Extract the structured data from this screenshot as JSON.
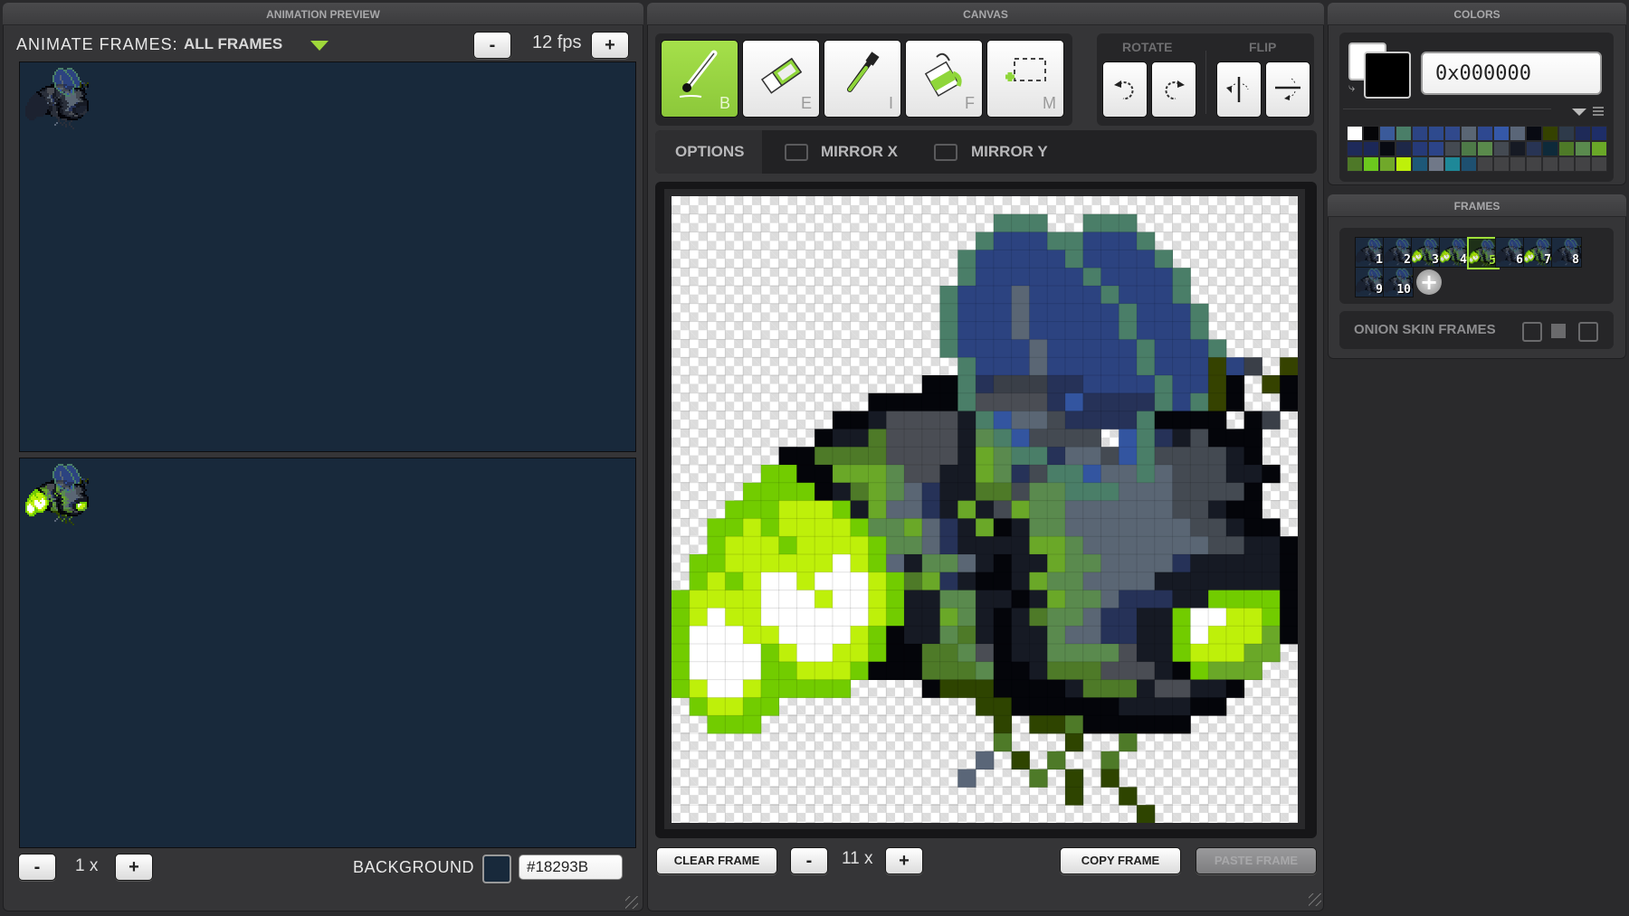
{
  "preview": {
    "header": "ANIMATION PREVIEW",
    "animate_label": "ANIMATE FRAMES:",
    "animate_value": "ALL FRAMES",
    "fps_minus": "-",
    "fps_value": "12 fps",
    "fps_plus": "+",
    "zoom_minus": "-",
    "zoom_value": "1 x",
    "zoom_plus": "+",
    "background_label": "BACKGROUND",
    "background_value": "#18293B",
    "background_color": "#18293B"
  },
  "canvas": {
    "header": "CANVAS",
    "tools": [
      {
        "name": "brush",
        "key": "B",
        "active": true
      },
      {
        "name": "eraser",
        "key": "E",
        "active": false
      },
      {
        "name": "eyedropper",
        "key": "I",
        "active": false
      },
      {
        "name": "fill",
        "key": "F",
        "active": false
      },
      {
        "name": "marquee",
        "key": "M",
        "active": false
      }
    ],
    "rotate_label": "ROTATE",
    "flip_label": "FLIP",
    "options_label": "OPTIONS",
    "mirror_x_label": "MIRROR X",
    "mirror_y_label": "MIRROR Y",
    "mirror_x_checked": false,
    "mirror_y_checked": false,
    "clear_frame": "CLEAR FRAME",
    "zoom_minus": "-",
    "zoom_value": "11 x",
    "zoom_plus": "+",
    "copy_frame": "COPY FRAME",
    "paste_frame": "PASTE FRAME",
    "paste_disabled": true
  },
  "colors": {
    "header": "COLORS",
    "primary": "#000000",
    "secondary": "#FFFFFF",
    "hex_value": "0x000000",
    "palette": [
      "#ffffff",
      "#050508",
      "#3a5a9a",
      "#4a7e68",
      "#2c4484",
      "#2e4a8e",
      "#30498c",
      "#5a6674",
      "#2e4890",
      "#3558a8",
      "#5a6678",
      "#080a12",
      "#354200",
      "#2e3a4a",
      "#1e2a58",
      "#1e2e68",
      "#1e2a5a",
      "#1c2858",
      "#080a12",
      "#1e2848",
      "#263a78",
      "#2c4488",
      "#444a52",
      "#4e7a48",
      "#5a8a4c",
      "#444a52",
      "#161a24",
      "#283454",
      "#0e2a3a",
      "#4e7a28",
      "#5a8a4e",
      "#6aa828",
      "#4e7828",
      "#6cc81e",
      "#70a82a",
      "#bef00a",
      "#1e5878",
      "#707888",
      "#1e8898",
      "#1e5070",
      "#434345",
      "#434345",
      "#434345",
      "#434345",
      "#434345",
      "#434345",
      "#434345",
      "#434345"
    ]
  },
  "frames": {
    "header": "FRAMES",
    "items": [
      {
        "num": "1",
        "selected": false,
        "glow": false
      },
      {
        "num": "2",
        "selected": false,
        "glow": false
      },
      {
        "num": "3",
        "selected": false,
        "glow": true
      },
      {
        "num": "4",
        "selected": false,
        "glow": true
      },
      {
        "num": "5",
        "selected": true,
        "glow": true
      },
      {
        "num": "6",
        "selected": false,
        "glow": false
      },
      {
        "num": "7",
        "selected": false,
        "glow": true
      },
      {
        "num": "8",
        "selected": false,
        "glow": false
      },
      {
        "num": "9",
        "selected": false,
        "glow": false
      },
      {
        "num": "10",
        "selected": false,
        "glow": false
      }
    ],
    "add_label": "+",
    "onion_label": "ONION SKIN FRAMES"
  },
  "sprite": {
    "palette": {
      "g": "#4a7e68",
      "b": "#2c4380",
      "s": "#5a6674",
      "o": "#354200",
      "D": "#3a3f48",
      "k": "#04050a",
      "n": "#263258",
      "d": "#161a24",
      "G": "#4a4d54",
      "L": "#6aa828",
      "m": "#5a8a4e",
      "l": "#72cc00",
      "y": "#bef00a",
      "w": "#ffffff",
      "O": "#4e7a28",
      "v": "#2e4400",
      "B": "#3355a0",
      "T": "#444a52",
      "S": "#5a6678"
    },
    "rows": [
      "...................................",
      "..................ggg..ggg.........",
      ".................gbbbggbbbg........",
      "................gbbbbbgbbbbg.......",
      "................gbbbbbbgbbbbg......",
      "...............gbbbsbbbbgbbbg......",
      "...............gbbbsbbbbbgbbbg.....",
      "...............gbbbsbbbbbgbbbg.....",
      "...............gbbbbsbbbbbgbbbg....",
      "................gbbbsbbbbbgbbbobD.oo",
      "..............kkgnDDDnnbbbbgbbok.ok",
      "...........kkkkkgGGGGnBnnnngbgok..k",
      ".........kkdGGGGdgBssTnnnngkkkk.kD.",
      "........kddOGGGGdmgBTTTT.BgndTkkk..",
      "......kkOOOOGGGGdLmggnssTBgTTTTdk..",
      ".....llkkLLLmGGddLmnTggBssgsTTTddk.",
      "....llllkdOLmsnddOOTmmgggsssTTTTk..",
      "...lllyyyldLssndLdTLmmssssssTTdkk..",
      "..llylyyyylmmLsndLkdmmsssssssTTdkk.",
      "..lyyylyyyylmmsnddddLLmsssssssTTddk",
      ".llyyyyyywylSdmmsdkddLmmssssndddddk",
      ".lylywwywwwylOLndkkdLmmssssdddddddk",
      "lyyyywwwywwylddmmddkdLmmsnnnddllllk",
      "lywyywwwwwwylddLmdkdOmmsnnddlwwyylk",
      "lwwwyywwwwylkddmOdkddmssnnddlwyyyLk",
      "lwwwwlywwyylkkOOmGkddmmmmGddlyyyLL.",
      "lwwwwllyyylkkkOOOmkkdOOOGGGdklLLL..",
      "lywwylllll....kvvvkkkkdOOOdGGddk...",
      ".lyyll...........vvkkkkkkddddkk....",
      "..lll.............v.vvOkkkkkk......",
      "..................O...v..O.........",
      ".................S.v.O..O..........",
      "................S...O.v.v..........",
      "......................v..v.........",
      "..........................v........"
    ]
  }
}
